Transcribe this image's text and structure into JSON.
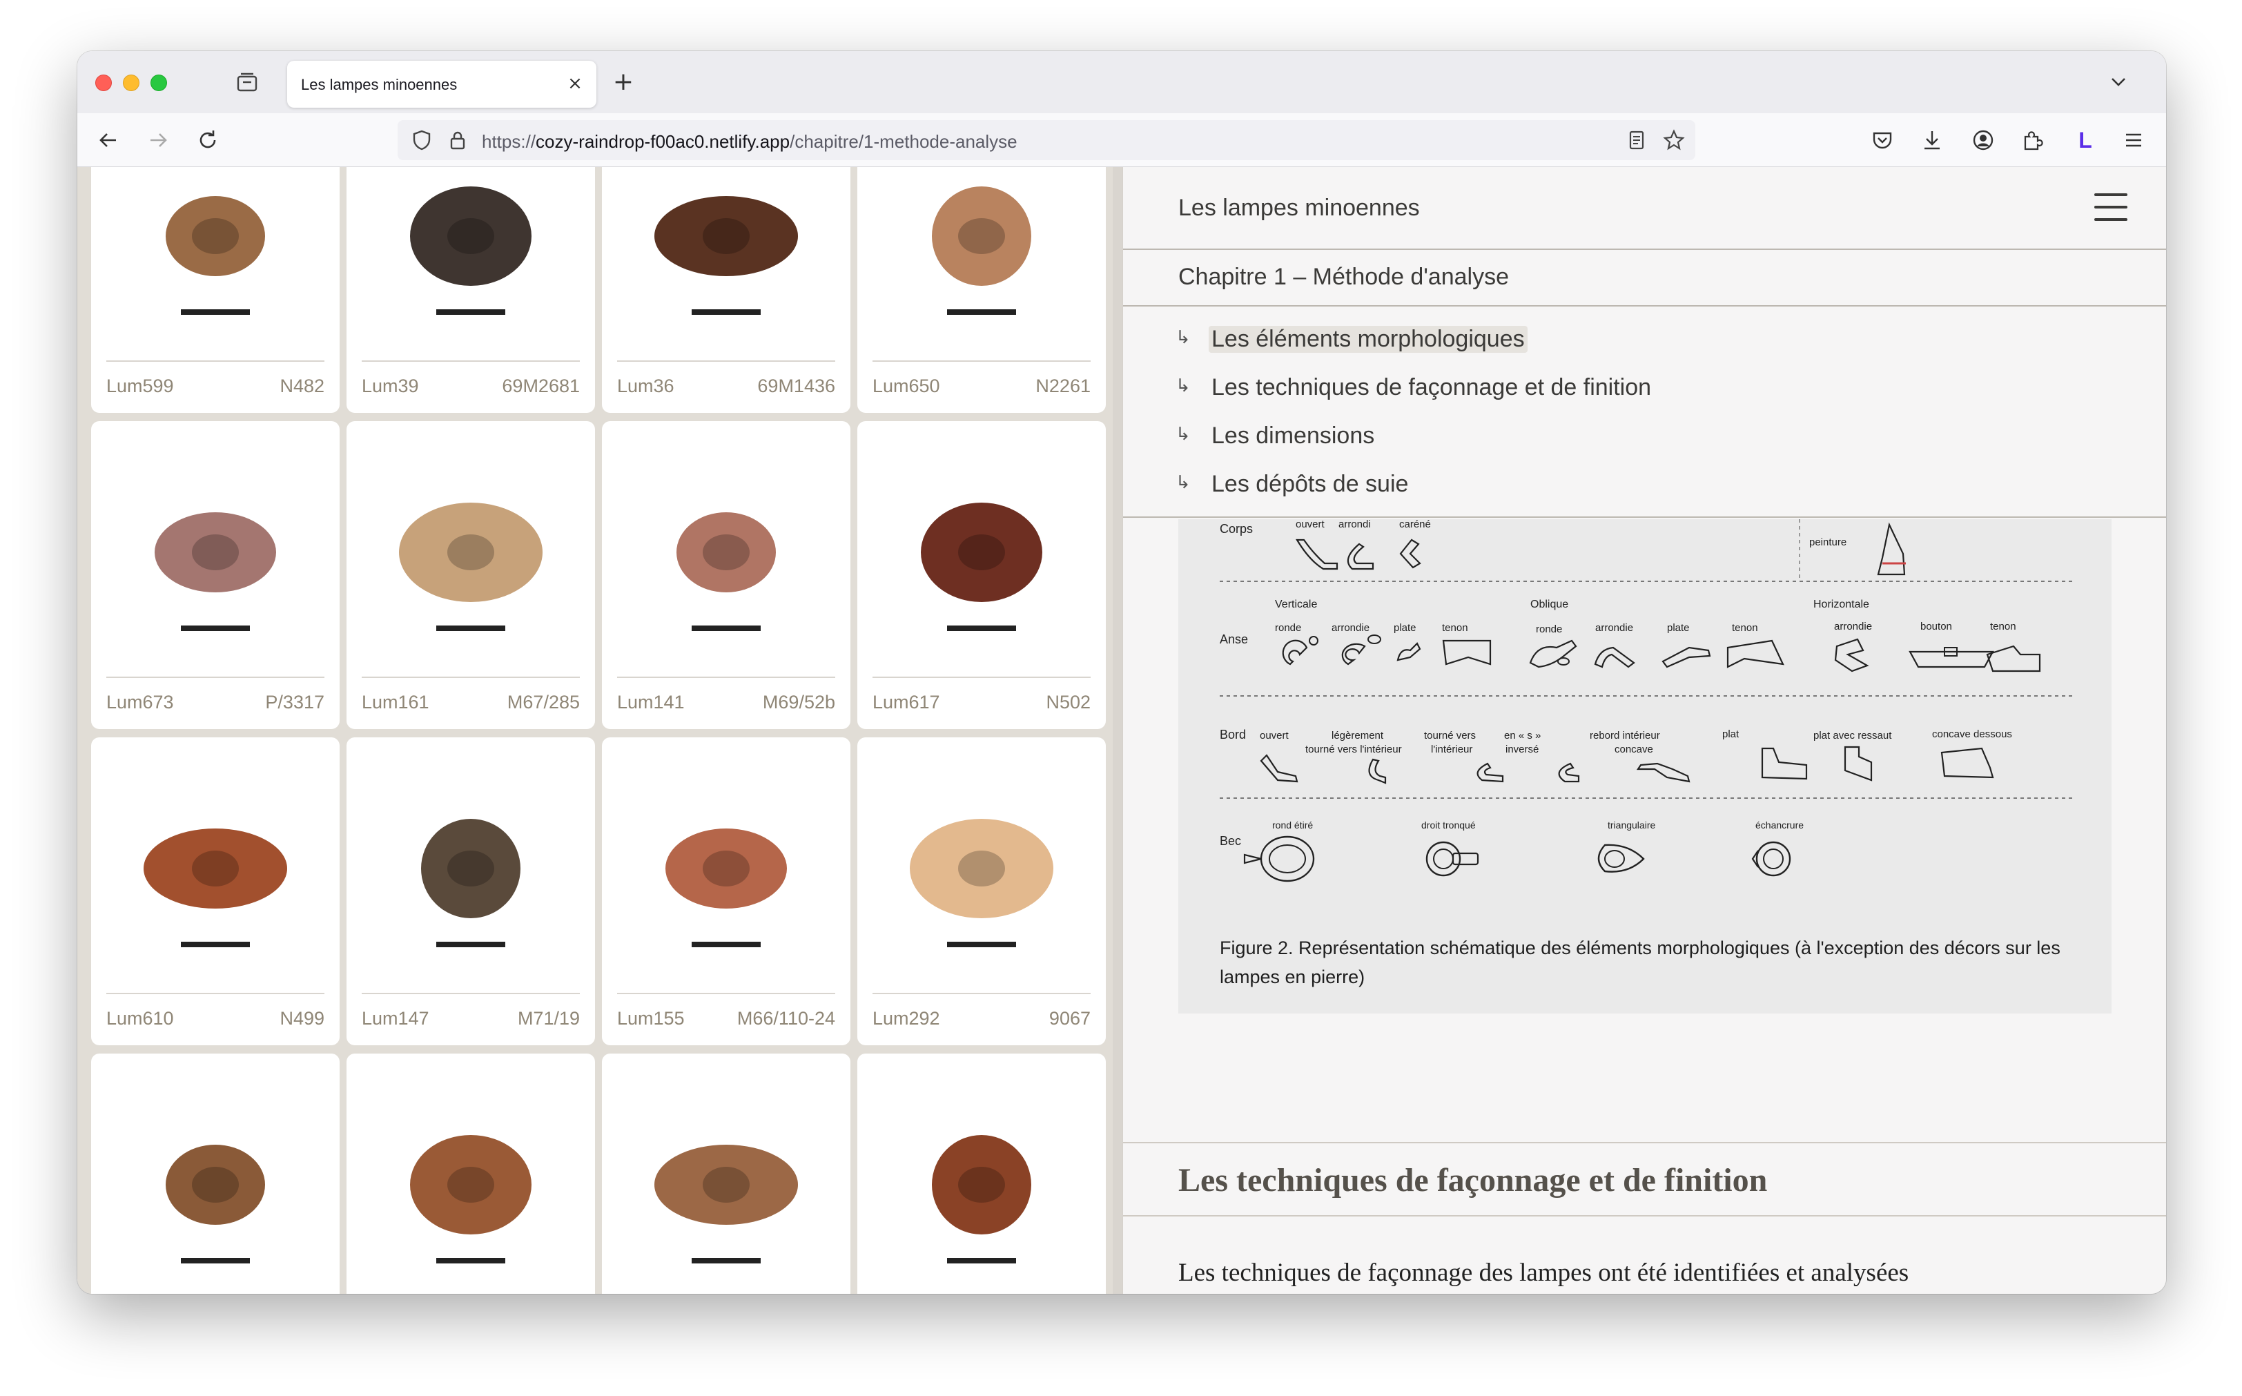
{
  "browser": {
    "tab_title": "Les lampes minoennes",
    "tab_close": "×",
    "new_tab": "+",
    "url_scheme": "https://",
    "url_host": "cozy-raindrop-f00ac0.netlify.app",
    "url_path": "/chapitre/1-methode-analyse",
    "profile_initial": "L",
    "colors": {
      "profile": "#5b2ee8"
    }
  },
  "gallery": {
    "cards": [
      {
        "id": "Lum599",
        "inv": "N482",
        "color": "#9a6b46"
      },
      {
        "id": "Lum39",
        "inv": "69M2681",
        "color": "#3f3530"
      },
      {
        "id": "Lum36",
        "inv": "69M1436",
        "color": "#5a3322"
      },
      {
        "id": "Lum650",
        "inv": "N2261",
        "color": "#b9835f"
      },
      {
        "id": "Lum673",
        "inv": "P/3317",
        "color": "#a47670"
      },
      {
        "id": "Lum161",
        "inv": "M67/285",
        "color": "#c7a27a"
      },
      {
        "id": "Lum141",
        "inv": "M69/52b",
        "color": "#b07564"
      },
      {
        "id": "Lum617",
        "inv": "N502",
        "color": "#6e2f22"
      },
      {
        "id": "Lum610",
        "inv": "N499",
        "color": "#a2502e"
      },
      {
        "id": "Lum147",
        "inv": "M71/19",
        "color": "#5a4a3b"
      },
      {
        "id": "Lum155",
        "inv": "M66/110-24",
        "color": "#b5664a"
      },
      {
        "id": "Lum292",
        "inv": "9067",
        "color": "#e3b98e"
      },
      {
        "id": "",
        "inv": "",
        "color": "#8a5a38"
      },
      {
        "id": "",
        "inv": "",
        "color": "#9a5a36"
      },
      {
        "id": "",
        "inv": "",
        "color": "#9c6846"
      },
      {
        "id": "",
        "inv": "",
        "color": "#8a4226"
      }
    ]
  },
  "reader": {
    "site_title": "Les lampes minoennes",
    "chapter_title": "Chapitre 1 – Méthode d'analyse",
    "toc": [
      {
        "label": "Les éléments morphologiques",
        "active": true
      },
      {
        "label": "Les techniques de façonnage et de finition",
        "active": false
      },
      {
        "label": "Les dimensions",
        "active": false
      },
      {
        "label": "Les dépôts de suie",
        "active": false
      }
    ],
    "toc_arrow": "↳",
    "figure": {
      "rows": {
        "corps": "Corps",
        "anse": "Anse",
        "bord": "Bord",
        "bec": "Bec"
      },
      "corps_labels": [
        "ouvert",
        "arrondi",
        "caréné"
      ],
      "peinture": "peinture",
      "anse_groups": [
        "Verticale",
        "Oblique",
        "Horizontale"
      ],
      "anse_labels": [
        "ronde",
        "arrondie",
        "plate",
        "tenon",
        "ronde",
        "arrondie",
        "plate",
        "tenon",
        "arrondie",
        "bouton",
        "tenon"
      ],
      "bord_labels": [
        [
          "ouvert"
        ],
        [
          "légèrement",
          "tourné vers l'intérieur"
        ],
        [
          "tourné vers",
          "l'intérieur"
        ],
        [
          "en « s »",
          "inversé"
        ],
        [
          "rebord intérieur",
          "concave"
        ],
        [
          "plat"
        ],
        [
          "plat avec ressaut"
        ],
        [
          "concave dessous"
        ]
      ],
      "bec_labels": [
        "rond étiré",
        "droit tronqué",
        "triangulaire",
        "échancrure"
      ],
      "caption": "Figure 2. Représentation schématique des éléments morphologiques (à l'exception des décors sur les lampes en pierre)"
    },
    "section_title": "Les techniques de façonnage et de finition",
    "body_text": "Les techniques de façonnage des lampes ont été identifiées et analysées"
  }
}
